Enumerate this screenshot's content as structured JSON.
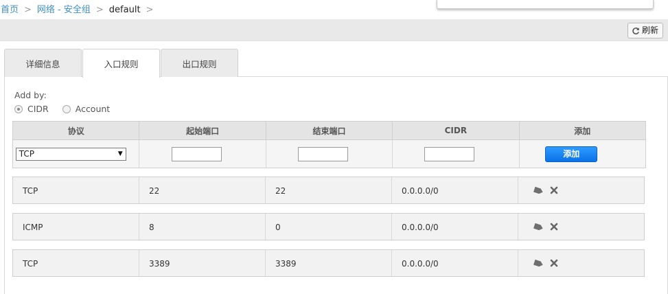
{
  "breadcrumb": {
    "home": "首页",
    "sep": ">",
    "section": "网络 - 安全组",
    "current": "default"
  },
  "toolbar": {
    "refresh_label": "刷新"
  },
  "tabs": [
    {
      "label": "详细信息",
      "active": false
    },
    {
      "label": "入口规则",
      "active": true
    },
    {
      "label": "出口规则",
      "active": false
    }
  ],
  "add_by": {
    "label": "Add by:",
    "options": [
      {
        "label": "CIDR",
        "checked": true
      },
      {
        "label": "Account",
        "checked": false
      }
    ]
  },
  "form": {
    "headers": [
      "协议",
      "起始端口",
      "结束端口",
      "CIDR",
      "添加"
    ],
    "protocol_value": "TCP",
    "start_port_value": "",
    "end_port_value": "",
    "cidr_value": "",
    "add_button_label": "添加"
  },
  "rules": [
    {
      "protocol": "TCP",
      "start": "22",
      "end": "22",
      "cidr": "0.0.0.0/0"
    },
    {
      "protocol": "ICMP",
      "start": "8",
      "end": "0",
      "cidr": "0.0.0.0/0"
    },
    {
      "protocol": "TCP",
      "start": "3389",
      "end": "3389",
      "cidr": "0.0.0.0/0"
    }
  ],
  "colors": {
    "link": "#3f8fc8",
    "add_button": "#1a86f5",
    "toolbar_bg": "#e9e9e9"
  },
  "icons": {
    "refresh": "refresh-icon",
    "tag": "tag-icon",
    "delete": "close-x-icon"
  }
}
